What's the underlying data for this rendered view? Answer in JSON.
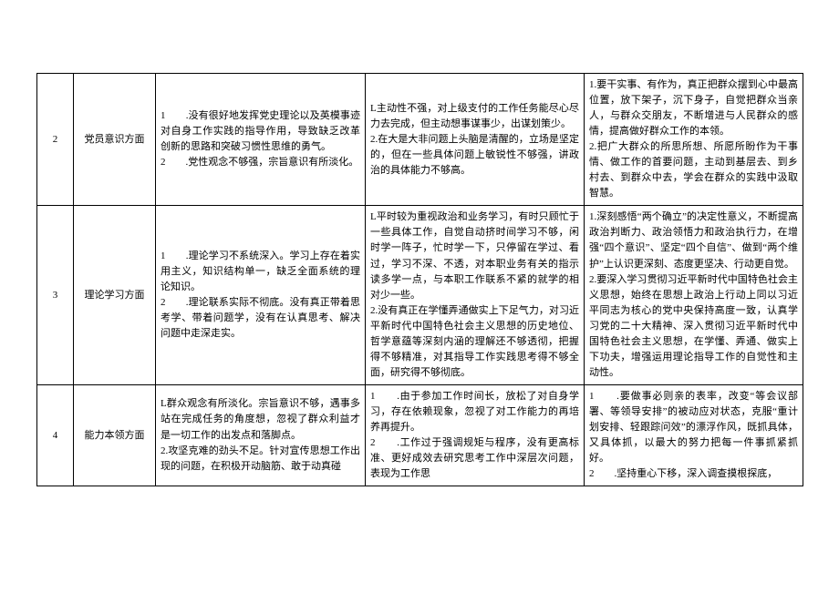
{
  "rows": [
    {
      "num": "2",
      "category": "党员意识方面",
      "col3": "1　　.没有很好地发挥党史理论以及英模事迹对自身工作实践的指导作用，导致缺乏改革创新的思路和突破习惯性思维的勇气。\n2　　.党性观念不够强，宗旨意识有所淡化。",
      "col4": "L主动性不强，对上级支付的工作任务能尽心尽力去完成，但主动想事谋事少，出谋划策少。\n2.在大是大非问题上头脑是清醒的，立场是坚定的，但在一些具体问题上敏锐性不够强，讲政治的具体能力不够高。",
      "col5": "1.要干实事、有作为，真正把群众摆到心中最高位置，放下架子，沉下身子，自觉把群众当亲人，与群众交朋友，不断增进与人民群众的感情，提高做好群众工作的本领。\n2.把广大群众的所思所想、所愿所盼作为干事情、做工作的首要问题，主动到基层去、到乡村去、到群众中去，学会在群众的实践中汲取智慧。"
    },
    {
      "num": "3",
      "category": "理论学习方面",
      "col3": "1　　.理论学习不系统深入。学习上存在着实用主义，知识结构单一，缺乏全面系统的理论知识。\n2　　.理论联系实际不彻底。没有真正带着思考学、带着问题学，没有在认真思考、解决问题中走深走实。",
      "col4": "L平时较为重视政治和业务学习，有时只顾忙于一些具体工作，自觉自动挤时间学习不够，闲时学一阵子，忙时学一下，只停留在学过、看过，学习不深、不透，对本职业务有关的指示读多学一点，与本职工作联系不紧的就学的相对少一些。\n2.没有真正在学懂弄通做实上下足气力，对习近平新时代中国特色社会主义思想的历史地位、哲学意蕴等深刻内涵的理解还不够透彻，把握得不够精准，对其指导工作实践思考得不够全面，研究得不够彻底。",
      "col5": "1.深刻感悟“两个确立”的决定性意义，不断提高政治判断力、政治领悟力和政治执行力，在增强“四个意识”、坚定“四个自信”、做到“两个维护”上认识更深刻、态度更坚决、行动更自觉。\n2.要深入学习贯彻习近平新时代中国特色社会主义思想，始终在思想上政治上行动上同以习近平同志为核心的党中央保持高度一致，认真学习党的二十大精神、深入贯彻习近平新时代中国特色社会主义思想，在学懂、弄通、做实上下功夫，增强运用理论指导工作的自觉性和主动性。"
    },
    {
      "num": "4",
      "category": "能力本领方面",
      "col3": "L群众观念有所淡化。宗旨意识不够，遇事多站在完成任务的角度想，忽视了群众利益才是一切工作的出发点和落脚点。\n2.攻坚克难的劲头不足。针对宣传思想工作出现的问题，在积极开动脑筋、敢于动真碰",
      "col4": "1　　.由于参加工作时间长，放松了对自身学习，存在依赖现象，忽视了对工作能力的再培养再提升。\n2　　.工作过于强调规矩与程序，没有更高标准、更好成效去研究思考工作中深层次问题，表现为工作思",
      "col5": "1　　.要做事必则亲的表率，改变“等会议部署、等领导安排”的被动应对状态，克服“重计划安排、轻跟踪问效”的漂浮作风，既抓具体，又具体抓，以最大的努力把每一件事抓紧抓好。\n2　　.坚持重心下移，深入调查摸根探底，"
    }
  ]
}
